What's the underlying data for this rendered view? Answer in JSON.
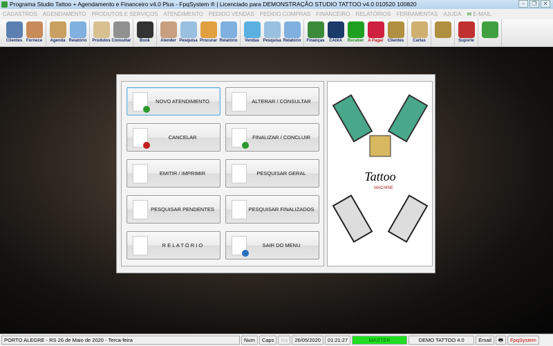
{
  "window": {
    "title": "Programa Studio Tattoo + Agendamento e Financeiro v4.0 Plus - FpqSystem ® | Licenciado para  DEMONSTRAÇÃO STUDIO TATTOO v4.0 010520 100820",
    "buttons": [
      "–",
      "❐",
      "✕"
    ]
  },
  "menu": [
    "CADASTROS",
    "AGENDAMENTO",
    "PRODUTOS E SERVIÇOS",
    "ATENDIMENTO",
    "PEDIDO VENDAS",
    "PEDIDO COMPRAS",
    "FINANCEIRO",
    "RELATÓRIOS",
    "FERRAMENTAS",
    "AJUDA"
  ],
  "menu_email": "E-MAIL",
  "toolbar": [
    [
      {
        "label": "Clientes",
        "color": "#5a7fb0"
      },
      {
        "label": "Fornece",
        "color": "#c98a5a"
      }
    ],
    [
      {
        "label": "Agenda",
        "color": "#c9a060"
      },
      {
        "label": "Relatório",
        "color": "#7fb0e0"
      }
    ],
    [
      {
        "label": "Produtos",
        "color": "#d8c090"
      },
      {
        "label": "Consultar",
        "color": "#909090"
      }
    ],
    [
      {
        "label": "Book",
        "color": "#333333"
      }
    ],
    [
      {
        "label": "Atender",
        "color": "#c8a080"
      },
      {
        "label": "Pesquisa",
        "color": "#9ac0e0"
      },
      {
        "label": "Procurar",
        "color": "#e0a040"
      },
      {
        "label": "Relatório",
        "color": "#7fb0e0"
      }
    ],
    [
      {
        "label": "Vendas",
        "color": "#5ab0e0"
      },
      {
        "label": "Pesquisa",
        "color": "#9ac0e0"
      },
      {
        "label": "Relatório",
        "color": "#7fb0e0"
      }
    ],
    [
      {
        "label": "Finanças",
        "color": "#3a8a3a"
      },
      {
        "label": "CAIXA",
        "color": "#1a3a6a"
      },
      {
        "label": "Receber",
        "color": "#20a020",
        "text_color": "#1a8a1a"
      },
      {
        "label": "A Pagar",
        "color": "#d02040",
        "text_color": "#c01010"
      },
      {
        "label": "Clientes",
        "color": "#b09040"
      }
    ],
    [
      {
        "label": "Cartas",
        "color": "#d0b070"
      }
    ],
    [
      {
        "label": "",
        "color": "#b09040"
      }
    ],
    [
      {
        "label": "Suporte",
        "color": "#c03030"
      }
    ],
    [
      {
        "label": "",
        "color": "#40a040"
      }
    ]
  ],
  "dialog": {
    "buttons": [
      {
        "label": "NOVO ATENDIMENTO",
        "icon": "new-document-icon",
        "badge": "#2a9a2a",
        "focused": true
      },
      {
        "label": "ALTERAR  /  CONSULTAR",
        "icon": "edit-pencil-icon"
      },
      {
        "label": "CANCELAR",
        "icon": "cancel-document-icon",
        "badge": "#c02020"
      },
      {
        "label": "FINALIZAR  /  CONCLUIR",
        "icon": "check-document-icon",
        "badge": "#2a9a2a"
      },
      {
        "label": "EMITIR  /  IMPRIMIR",
        "icon": "print-person-icon"
      },
      {
        "label": "PESQUISAR GERAL",
        "icon": "search-people-icon"
      },
      {
        "label": "PESQUISAR PENDENTES",
        "icon": "search-pending-icon"
      },
      {
        "label": "PESQUISAR FINALIZADOS",
        "icon": "search-finished-icon"
      },
      {
        "label": "R E L A T Ó R I O",
        "icon": "printer-icon"
      },
      {
        "label": "SAIR DO MENU",
        "icon": "exit-menu-icon",
        "badge": "#2a70c0"
      }
    ],
    "art_text": "Tattoo",
    "art_sub": "MACHINE"
  },
  "status": {
    "location": "PORTO ALEGRE - RS 26 de Maio de 2020 - Terca-feira",
    "num": "Num",
    "caps": "Caps",
    "ins": "Ins",
    "date": "26/05/2020",
    "time": "01:21:27",
    "user": "MASTER",
    "user_color": "#22dd22",
    "company": "DEMO TATTOO 4.0",
    "email": "Email",
    "brand": "FpqSystem"
  }
}
